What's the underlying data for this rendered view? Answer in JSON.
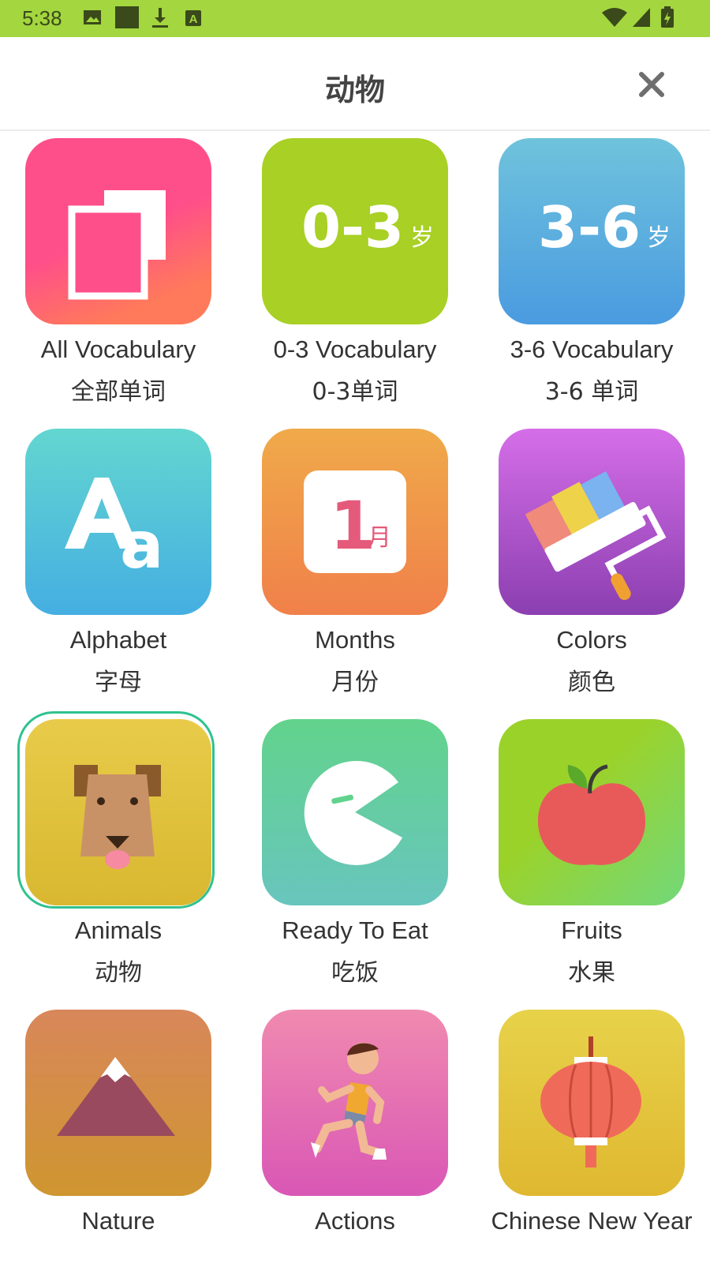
{
  "status_bar": {
    "time": "5:38"
  },
  "header": {
    "title": "动物",
    "close_icon": "close-icon"
  },
  "categories": [
    {
      "en": "All Vocabulary",
      "zh": "全部单词",
      "icon": "all-vocabulary-icon",
      "colors": [
        "#ff4f8a",
        "#ff7a5a"
      ]
    },
    {
      "en": "0-3 Vocabulary",
      "zh": "0-3单词",
      "icon": "age-0-3-icon",
      "badge": "0-3",
      "unit": "岁",
      "colors": [
        "#a8d025",
        "#a8d025"
      ]
    },
    {
      "en": "3-6 Vocabulary",
      "zh": "3-6 单词",
      "icon": "age-3-6-icon",
      "badge": "3-6",
      "unit": "岁",
      "colors": [
        "#6fc3dc",
        "#4a9be0"
      ]
    },
    {
      "en": "Alphabet",
      "zh": "字母",
      "icon": "alphabet-icon",
      "colors": [
        "#63d6d0",
        "#45aee2"
      ]
    },
    {
      "en": "Months",
      "zh": "月份",
      "icon": "calendar-icon",
      "badge": "1",
      "unit": "月",
      "colors": [
        "#f0aa4a",
        "#f0804a"
      ]
    },
    {
      "en": "Colors",
      "zh": "颜色",
      "icon": "paint-roller-icon",
      "colors": [
        "#d56ee8",
        "#8b3fb0"
      ]
    },
    {
      "en": "Animals",
      "zh": "动物",
      "icon": "dog-icon",
      "selected": true,
      "colors": [
        "#e8cb4a",
        "#d9b830"
      ]
    },
    {
      "en": "Ready To Eat",
      "zh": "吃饭",
      "icon": "eating-icon",
      "colors": [
        "#62d38c",
        "#68c5bd"
      ]
    },
    {
      "en": "Fruits",
      "zh": "水果",
      "icon": "apple-icon",
      "colors": [
        "#9bd22a",
        "#72d87a"
      ]
    },
    {
      "en": "Nature",
      "zh": "",
      "icon": "mountain-icon",
      "colors": [
        "#d8875a",
        "#cf9630"
      ]
    },
    {
      "en": "Actions",
      "zh": "",
      "icon": "runner-icon",
      "colors": [
        "#f08ab0",
        "#d957b5"
      ]
    },
    {
      "en": "Chinese New Year",
      "zh": "",
      "icon": "lantern-icon",
      "colors": [
        "#e7d24a",
        "#dfb830"
      ]
    }
  ]
}
